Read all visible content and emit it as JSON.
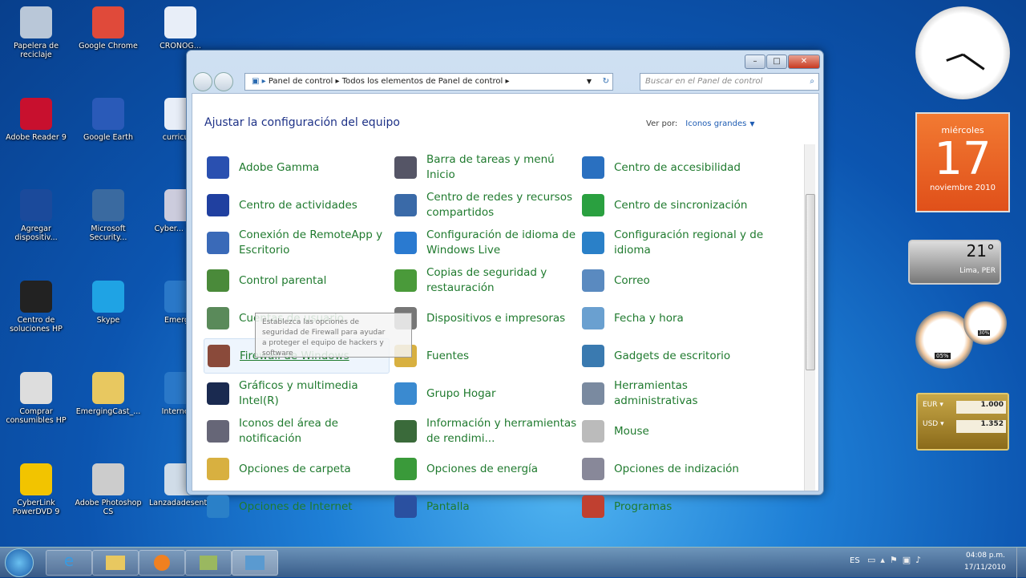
{
  "desktop": {
    "icons": [
      {
        "label": "Papelera de reciclaje",
        "color": "#b9c7d8"
      },
      {
        "label": "Google Chrome",
        "color": "#e04a3a"
      },
      {
        "label": "CRONOG...",
        "color": "#e8eef8"
      },
      {
        "label": "Adobe Reader 9",
        "color": "#c8102e"
      },
      {
        "label": "Google Earth",
        "color": "#2a5ab8"
      },
      {
        "label": "curricul...",
        "color": "#e8eef8"
      },
      {
        "label": "Agregar dispositiv...",
        "color": "#1b4a9b"
      },
      {
        "label": "Microsoft Security...",
        "color": "#3a6aa0"
      },
      {
        "label": "Cyber... You...",
        "color": "#ccd"
      },
      {
        "label": "Centro de soluciones HP",
        "color": "#222"
      },
      {
        "label": "Skype",
        "color": "#1fa3e4"
      },
      {
        "label": "Emerg...",
        "color": "#2a78c8"
      },
      {
        "label": "Comprar consumibles HP",
        "color": "#ddd"
      },
      {
        "label": "EmergingCast_...",
        "color": "#e8c860"
      },
      {
        "label": "Internet...",
        "color": "#2a78c8"
      },
      {
        "label": "CyberLink PowerDVD 9",
        "color": "#f2c400"
      },
      {
        "label": "Adobe Photoshop CS",
        "color": "#ccc"
      },
      {
        "label": "Lanzadadesenta",
        "color": "#d0dce8"
      }
    ]
  },
  "window": {
    "controls": {
      "minimize": "–",
      "maximize": "□",
      "close": "✕"
    },
    "breadcrumb": [
      "Panel de control",
      "Todos los elementos de Panel de control"
    ],
    "search_placeholder": "Buscar en el Panel de control",
    "heading": "Ajustar la configuración del equipo",
    "view_by_label": "Ver por:",
    "view_by_value": "Iconos grandes",
    "items": [
      [
        "Adobe Gamma",
        "Barra de tareas y menú Inicio",
        "Centro de accesibilidad"
      ],
      [
        "Centro de actividades",
        "Centro de redes y recursos compartidos",
        "Centro de sincronización"
      ],
      [
        "Conexión de RemoteApp y Escritorio",
        "Configuración de idioma de Windows Live",
        "Configuración regional y de idioma"
      ],
      [
        "Control parental",
        "Copias de seguridad y restauración",
        "Correo"
      ],
      [
        "Cuentas de usuario",
        "Dispositivos e impresoras",
        "Fecha y hora"
      ],
      [
        "Firewall de Windows",
        "Fuentes",
        "Gadgets de escritorio"
      ],
      [
        "Gráficos y multimedia Intel(R)",
        "Grupo Hogar",
        "Herramientas administrativas"
      ],
      [
        "Iconos del área de notificación",
        "Información y herramientas de rendimi...",
        "Mouse"
      ],
      [
        "Opciones de carpeta",
        "Opciones de energía",
        "Opciones de indización"
      ],
      [
        "Opciones de Internet",
        "Pantalla",
        "Programas"
      ]
    ],
    "icon_colors": [
      [
        "#2a50b0",
        "#556",
        "#2a70c0"
      ],
      [
        "#2040a0",
        "#3a6aa8",
        "#2aa040"
      ],
      [
        "#3a6ab8",
        "#2a7ad0",
        "#2a80c8"
      ],
      [
        "#4a8a3a",
        "#4a9a3a",
        "#5a8ac0"
      ],
      [
        "#5a8a5a",
        "#777",
        "#6aa0d0"
      ],
      [
        "#8a4a3a",
        "#d8b040",
        "#3a7ab0"
      ],
      [
        "#1a2a50",
        "#3a8ad0",
        "#7a8aa0"
      ],
      [
        "#667",
        "#3a6a3a",
        "#bbb"
      ],
      [
        "#d8b040",
        "#3a9a3a",
        "#889"
      ],
      [
        "#2a80c8",
        "#2a50a0",
        "#c04030"
      ]
    ],
    "tooltip": "Establezca las opciones de seguridad de Firewall para ayudar a proteger el equipo de hackers y software"
  },
  "gadgets": {
    "calendar": {
      "weekday": "miércoles",
      "day": "17",
      "month_year": "noviembre 2010"
    },
    "weather": {
      "temp": "21°",
      "location": "Lima, PER"
    },
    "cpu": {
      "cpu": "05%",
      "ram": "30%"
    },
    "currency": {
      "rows": [
        {
          "code": "EUR",
          "value": "1.000"
        },
        {
          "code": "USD",
          "value": "1.352"
        }
      ]
    }
  },
  "taskbar": {
    "lang": "ES",
    "time": "04:08 p.m.",
    "date": "17/11/2010"
  }
}
